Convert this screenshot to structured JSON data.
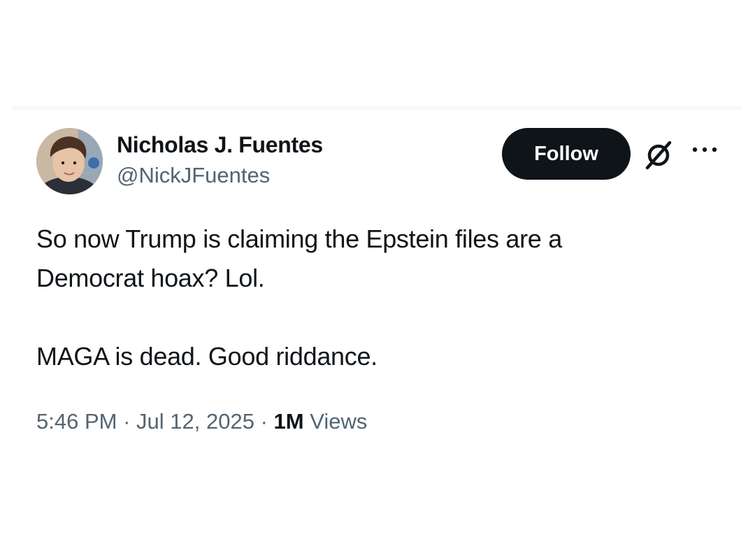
{
  "author": {
    "display_name": "Nicholas J. Fuentes",
    "handle": "@NickJFuentes"
  },
  "actions": {
    "follow_label": "Follow",
    "grok_icon": "grok-icon",
    "more_icon": "more-icon"
  },
  "tweet": {
    "line1": "So now Trump is claiming the Epstein files are a",
    "line2": "Democrat hoax? Lol.",
    "line3": "MAGA is dead. Good riddance."
  },
  "meta": {
    "time": "5:46 PM",
    "separator": "·",
    "date": "Jul 12, 2025",
    "views_count": "1M",
    "views_label": "Views"
  },
  "colors": {
    "text_primary": "#0f1419",
    "text_secondary": "#536471",
    "follow_bg": "#0f1419",
    "follow_text": "#ffffff"
  }
}
